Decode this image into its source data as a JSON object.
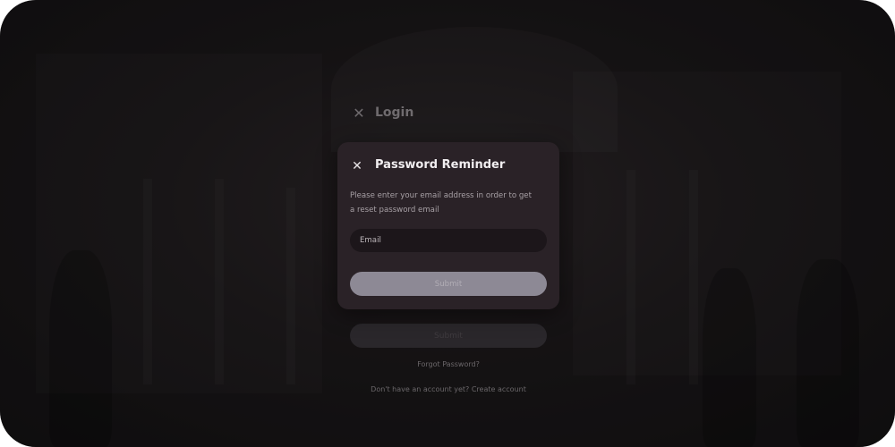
{
  "login": {
    "close_icon": "close-icon",
    "close_glyph": "✕",
    "title": "Login",
    "submit_label": "Submit",
    "forgot_password": "Forgot Password?",
    "signup_prompt": "Don't have an account yet? Create account"
  },
  "modal": {
    "close_icon": "close-icon",
    "close_glyph": "✕",
    "title": "Password Reminder",
    "description": "Please enter your email address in order to get a reset password email",
    "email_placeholder": "Email",
    "email_value": "",
    "submit_label": "Submit"
  },
  "colors": {
    "modal_bg": "#2a2227",
    "submit_bg": "#8d8995",
    "input_bg": "#1c161a"
  }
}
